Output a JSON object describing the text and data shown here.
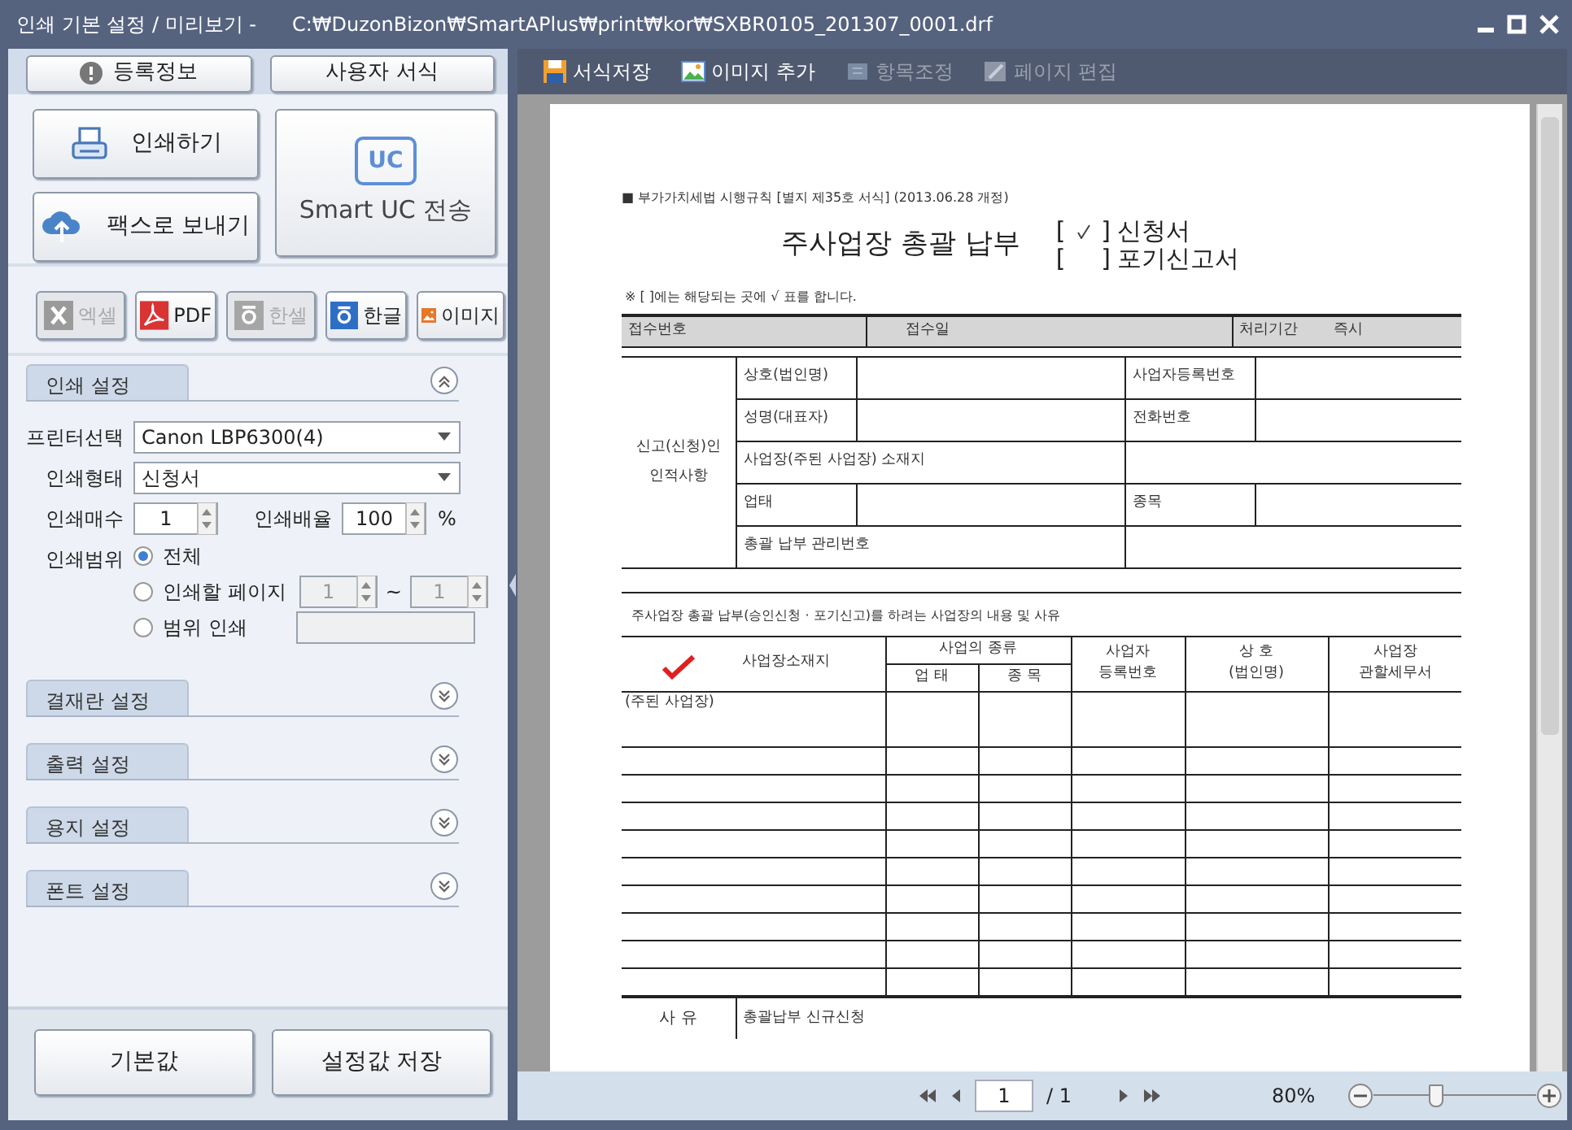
{
  "window": {
    "title": "인쇄 기본 설정 / 미리보기 -",
    "path": "C:₩DuzonBizon₩SmartAPlus₩print₩kor₩SXBR0105_201307_0001.drf"
  },
  "top_buttons": [
    {
      "label": "등록정보",
      "kind": "info"
    },
    {
      "label": "사용자 서식",
      "kind": "plain"
    }
  ],
  "action_buttons": [
    {
      "label": "인쇄하기",
      "kind": "print"
    },
    {
      "label": "팩스로 보내기",
      "kind": "fax"
    },
    {
      "label": "Smart UC 전송",
      "kind": "uc",
      "badge": "UC"
    }
  ],
  "export_buttons": [
    {
      "label": "엑셀",
      "kind": "excel",
      "disabled": true
    },
    {
      "label": "PDF",
      "kind": "pdf",
      "disabled": false
    },
    {
      "label": "한셀",
      "kind": "hancell",
      "disabled": true
    },
    {
      "label": "한글",
      "kind": "hangul",
      "disabled": false
    },
    {
      "label": "이미지",
      "kind": "image",
      "disabled": false
    }
  ],
  "print_settings": {
    "title": "인쇄 설정",
    "expanded": true,
    "printer": {
      "label": "프린터선택",
      "value": "Canon LBP6300(4)"
    },
    "form_type": {
      "label": "인쇄형태",
      "value": "신청서"
    },
    "copies": {
      "label": "인쇄매수",
      "value": "1"
    },
    "scale": {
      "label": "인쇄배율",
      "value": "100",
      "unit": "%"
    },
    "range": {
      "label": "인쇄범위",
      "options": [
        {
          "label": "전체",
          "selected": true,
          "kind": "plain"
        },
        {
          "label": "인쇄할 페이지",
          "selected": false,
          "kind": "pages",
          "from": "1",
          "separator": "~",
          "to": "1"
        },
        {
          "label": "범위 인쇄",
          "selected": false,
          "kind": "text"
        }
      ]
    }
  },
  "sections": [
    {
      "title": "결재란 설정",
      "expanded": false
    },
    {
      "title": "출력 설정",
      "expanded": false
    },
    {
      "title": "용지 설정",
      "expanded": false
    },
    {
      "title": "폰트 설정",
      "expanded": false
    }
  ],
  "bottom_buttons": [
    "기본값",
    "설정값 저장"
  ],
  "toolbar": [
    {
      "label": "서식저장",
      "kind": "save",
      "disabled": false
    },
    {
      "label": "이미지 추가",
      "kind": "image",
      "disabled": false
    },
    {
      "label": "항목조정",
      "kind": "adjust",
      "disabled": true
    },
    {
      "label": "페이지 편집",
      "kind": "edit",
      "disabled": true
    }
  ],
  "document": {
    "header_note": "■ 부가가치세법 시행규칙 [별지 제35호 서식] (2013.06.28 개정)",
    "title": "주사업장 총괄 납부",
    "options": [
      {
        "bracket_open": "[",
        "bracket_close": "]",
        "label": "신청서",
        "checked": true
      },
      {
        "bracket_open": "[",
        "bracket_close": "]",
        "label": "포기신고서",
        "checked": false
      }
    ],
    "instruction": "※ [ ]에는 해당되는 곳에 √ 표를 합니다.",
    "receipt": {
      "number_label": "접수번호",
      "date_label": "접수일",
      "period_label": "처리기간",
      "period_value": "즉시"
    },
    "applicant": {
      "label": "신고(신청)인 인적사항",
      "name_label": "상호(법인명)",
      "regno_label": "사업자등록번호",
      "rep_label": "성명(대표자)",
      "phone_label": "전화번호",
      "address_label": "사업장(주된 사업장) 소재지",
      "type_label": "업태",
      "item_label": "종목",
      "mgmt_label": "총괄 납부 관리번호"
    },
    "reason_title": "주사업장 총괄 납부(승인신청 · 포기신고)를 하려는 사업장의 내용 및 사유",
    "columns": {
      "location": "사업장소재지",
      "business": "사업의 종류",
      "type": "업 태",
      "item": "종 목",
      "regno": "사업자 등록번호",
      "name": "상 호 (법인명)",
      "office": "사업장 관할세무서"
    },
    "first_row": "(주된 사업장)",
    "reason_label": "사 유",
    "reason_value": "총괄납부 신규신청"
  },
  "pager": {
    "page": "1",
    "total": "/ 1",
    "zoom": "80%",
    "level": 0.38
  }
}
